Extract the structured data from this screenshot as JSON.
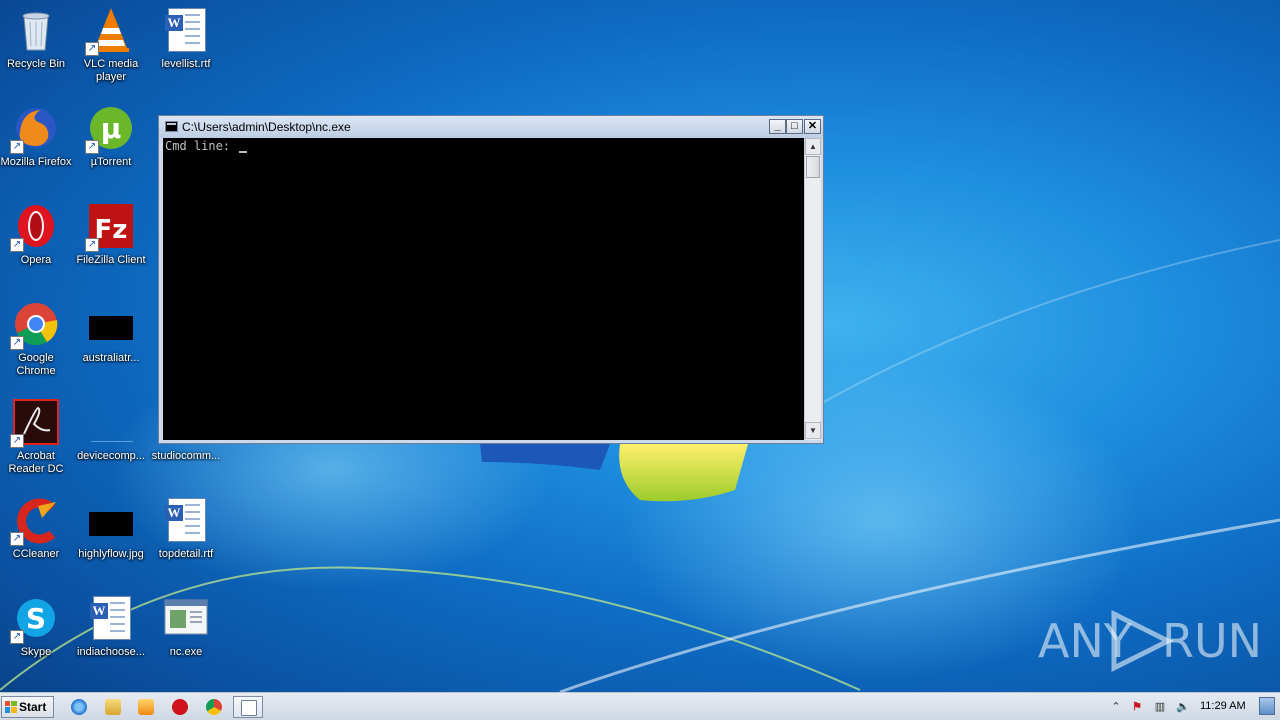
{
  "desktop": {
    "icons": [
      {
        "label": "Recycle Bin",
        "icon": "recycle-bin-icon"
      },
      {
        "label": "VLC media player",
        "icon": "vlc-icon"
      },
      {
        "label": "levellist.rtf",
        "icon": "word-document-icon"
      },
      {
        "label": "Mozilla Firefox",
        "icon": "firefox-icon"
      },
      {
        "label": "µTorrent",
        "icon": "utorrent-icon"
      },
      {
        "label": "Opera",
        "icon": "opera-icon"
      },
      {
        "label": "FileZilla Client",
        "icon": "filezilla-icon"
      },
      {
        "label": "Google Chrome",
        "icon": "chrome-icon"
      },
      {
        "label": "australiatr...",
        "icon": "image-file-icon"
      },
      {
        "label": "Acrobat Reader DC",
        "icon": "acrobat-icon"
      },
      {
        "label": "devicecomp...",
        "icon": "file-icon"
      },
      {
        "label": "studiocomm...",
        "icon": "file-icon"
      },
      {
        "label": "CCleaner",
        "icon": "ccleaner-icon"
      },
      {
        "label": "highlyflow.jpg",
        "icon": "image-file-icon"
      },
      {
        "label": "topdetail.rtf",
        "icon": "word-document-icon"
      },
      {
        "label": "Skype",
        "icon": "skype-icon"
      },
      {
        "label": "indiachoose...",
        "icon": "word-document-icon"
      },
      {
        "label": "nc.exe",
        "icon": "executable-icon"
      }
    ]
  },
  "console": {
    "title": "C:\\Users\\admin\\Desktop\\nc.exe",
    "prompt": "Cmd line: ",
    "buttons": {
      "minimize": "_",
      "maximize": "□",
      "close": "✕"
    }
  },
  "watermark": {
    "left": "ANY",
    "right": "RUN"
  },
  "taskbar": {
    "start_label": "Start",
    "pinned": [
      "internet-explorer-icon",
      "explorer-icon",
      "media-player-icon",
      "opera-icon",
      "chrome-icon",
      "console-icon"
    ],
    "tray": {
      "clock": "11:29 AM"
    }
  }
}
